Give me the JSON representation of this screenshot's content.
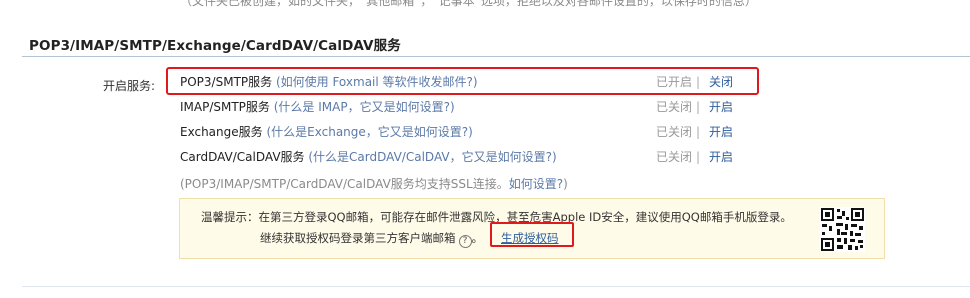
{
  "top_cut_text": "（文件夹已被创建，如的文件夹，“其他邮箱”，“记事本”选项，拒绝以及对各邮件设置的，以保存时的信息）",
  "section": {
    "title": "POP3/IMAP/SMTP/Exchange/CardDAV/CalDAV服务",
    "label": "开启服务:"
  },
  "services": [
    {
      "name": "POP3/SMTP服务",
      "paren_open": " (",
      "help": "如何使用 Foxmail 等软件收发邮件?",
      "paren_close": ")",
      "status": "已开启",
      "sep": "|",
      "action": "关闭"
    },
    {
      "name": "IMAP/SMTP服务",
      "paren_open": " (",
      "help": "什么是 IMAP，它又是如何设置?",
      "paren_close": ")",
      "status": "已关闭",
      "sep": "|",
      "action": "开启"
    },
    {
      "name": "Exchange服务",
      "paren_open": " (",
      "help": "什么是Exchange，它又是如何设置?",
      "paren_close": ")",
      "status": "已关闭",
      "sep": "|",
      "action": "开启"
    },
    {
      "name": "CardDAV/CalDAV服务",
      "paren_open": " (",
      "help": "什么是CardDAV/CalDAV，它又是如何设置?",
      "paren_close": ")",
      "status": "已关闭",
      "sep": "|",
      "action": "开启"
    }
  ],
  "ssl_note": {
    "text": "(POP3/IMAP/SMTP/CardDAV/CalDAV服务均支持SSL连接。",
    "link": "如何设置?",
    "close": ")"
  },
  "tip": {
    "line1": "温馨提示：在第三方登录QQ邮箱，可能存在邮件泄露风险，甚至危害Apple ID安全，建议使用QQ邮箱手机版登录。",
    "line2": "继续获取授权码登录第三方客户端邮箱",
    "help_icon_glyph": "?",
    "line2_end": "。",
    "generate_link": "生成授权码",
    "qr_icon": "qr-code-icon"
  },
  "colors": {
    "highlight_red": "#e0191c",
    "link_blue": "#2e5e9e",
    "tip_bg": "#fffbe9"
  }
}
